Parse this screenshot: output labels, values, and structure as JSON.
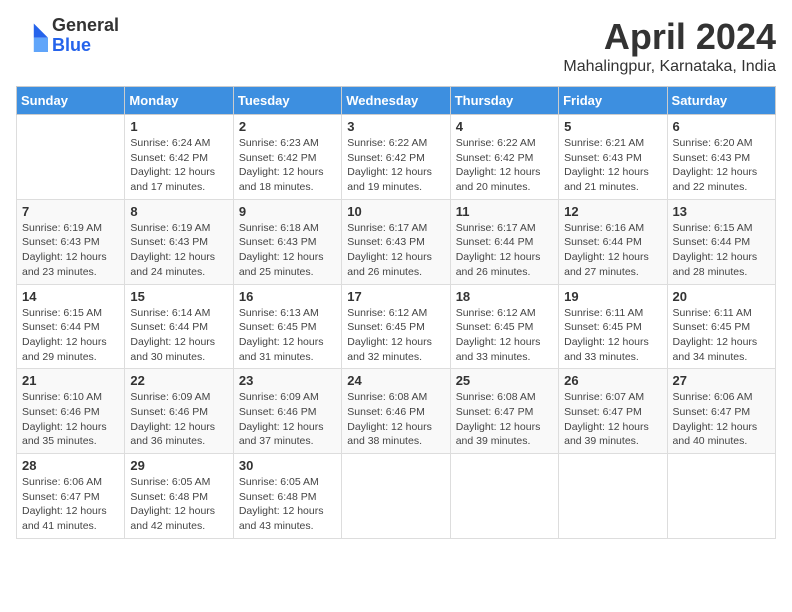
{
  "logo": {
    "general": "General",
    "blue": "Blue"
  },
  "title": "April 2024",
  "subtitle": "Mahalingpur, Karnataka, India",
  "weekdays": [
    "Sunday",
    "Monday",
    "Tuesday",
    "Wednesday",
    "Thursday",
    "Friday",
    "Saturday"
  ],
  "weeks": [
    [
      {
        "day": "",
        "info": ""
      },
      {
        "day": "1",
        "info": "Sunrise: 6:24 AM\nSunset: 6:42 PM\nDaylight: 12 hours and 17 minutes."
      },
      {
        "day": "2",
        "info": "Sunrise: 6:23 AM\nSunset: 6:42 PM\nDaylight: 12 hours and 18 minutes."
      },
      {
        "day": "3",
        "info": "Sunrise: 6:22 AM\nSunset: 6:42 PM\nDaylight: 12 hours and 19 minutes."
      },
      {
        "day": "4",
        "info": "Sunrise: 6:22 AM\nSunset: 6:42 PM\nDaylight: 12 hours and 20 minutes."
      },
      {
        "day": "5",
        "info": "Sunrise: 6:21 AM\nSunset: 6:43 PM\nDaylight: 12 hours and 21 minutes."
      },
      {
        "day": "6",
        "info": "Sunrise: 6:20 AM\nSunset: 6:43 PM\nDaylight: 12 hours and 22 minutes."
      }
    ],
    [
      {
        "day": "7",
        "info": "Sunrise: 6:19 AM\nSunset: 6:43 PM\nDaylight: 12 hours and 23 minutes."
      },
      {
        "day": "8",
        "info": "Sunrise: 6:19 AM\nSunset: 6:43 PM\nDaylight: 12 hours and 24 minutes."
      },
      {
        "day": "9",
        "info": "Sunrise: 6:18 AM\nSunset: 6:43 PM\nDaylight: 12 hours and 25 minutes."
      },
      {
        "day": "10",
        "info": "Sunrise: 6:17 AM\nSunset: 6:43 PM\nDaylight: 12 hours and 26 minutes."
      },
      {
        "day": "11",
        "info": "Sunrise: 6:17 AM\nSunset: 6:44 PM\nDaylight: 12 hours and 26 minutes."
      },
      {
        "day": "12",
        "info": "Sunrise: 6:16 AM\nSunset: 6:44 PM\nDaylight: 12 hours and 27 minutes."
      },
      {
        "day": "13",
        "info": "Sunrise: 6:15 AM\nSunset: 6:44 PM\nDaylight: 12 hours and 28 minutes."
      }
    ],
    [
      {
        "day": "14",
        "info": "Sunrise: 6:15 AM\nSunset: 6:44 PM\nDaylight: 12 hours and 29 minutes."
      },
      {
        "day": "15",
        "info": "Sunrise: 6:14 AM\nSunset: 6:44 PM\nDaylight: 12 hours and 30 minutes."
      },
      {
        "day": "16",
        "info": "Sunrise: 6:13 AM\nSunset: 6:45 PM\nDaylight: 12 hours and 31 minutes."
      },
      {
        "day": "17",
        "info": "Sunrise: 6:12 AM\nSunset: 6:45 PM\nDaylight: 12 hours and 32 minutes."
      },
      {
        "day": "18",
        "info": "Sunrise: 6:12 AM\nSunset: 6:45 PM\nDaylight: 12 hours and 33 minutes."
      },
      {
        "day": "19",
        "info": "Sunrise: 6:11 AM\nSunset: 6:45 PM\nDaylight: 12 hours and 33 minutes."
      },
      {
        "day": "20",
        "info": "Sunrise: 6:11 AM\nSunset: 6:45 PM\nDaylight: 12 hours and 34 minutes."
      }
    ],
    [
      {
        "day": "21",
        "info": "Sunrise: 6:10 AM\nSunset: 6:46 PM\nDaylight: 12 hours and 35 minutes."
      },
      {
        "day": "22",
        "info": "Sunrise: 6:09 AM\nSunset: 6:46 PM\nDaylight: 12 hours and 36 minutes."
      },
      {
        "day": "23",
        "info": "Sunrise: 6:09 AM\nSunset: 6:46 PM\nDaylight: 12 hours and 37 minutes."
      },
      {
        "day": "24",
        "info": "Sunrise: 6:08 AM\nSunset: 6:46 PM\nDaylight: 12 hours and 38 minutes."
      },
      {
        "day": "25",
        "info": "Sunrise: 6:08 AM\nSunset: 6:47 PM\nDaylight: 12 hours and 39 minutes."
      },
      {
        "day": "26",
        "info": "Sunrise: 6:07 AM\nSunset: 6:47 PM\nDaylight: 12 hours and 39 minutes."
      },
      {
        "day": "27",
        "info": "Sunrise: 6:06 AM\nSunset: 6:47 PM\nDaylight: 12 hours and 40 minutes."
      }
    ],
    [
      {
        "day": "28",
        "info": "Sunrise: 6:06 AM\nSunset: 6:47 PM\nDaylight: 12 hours and 41 minutes."
      },
      {
        "day": "29",
        "info": "Sunrise: 6:05 AM\nSunset: 6:48 PM\nDaylight: 12 hours and 42 minutes."
      },
      {
        "day": "30",
        "info": "Sunrise: 6:05 AM\nSunset: 6:48 PM\nDaylight: 12 hours and 43 minutes."
      },
      {
        "day": "",
        "info": ""
      },
      {
        "day": "",
        "info": ""
      },
      {
        "day": "",
        "info": ""
      },
      {
        "day": "",
        "info": ""
      }
    ]
  ]
}
